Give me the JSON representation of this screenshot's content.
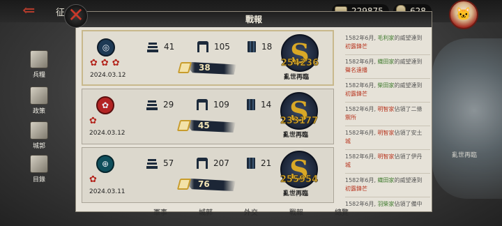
{
  "topbar": {
    "title": "征",
    "resource1": "229875",
    "resource2": "628"
  },
  "scene": {
    "caption": "亂世再臨"
  },
  "sidebar": {
    "items": [
      {
        "label": "兵糧",
        "icon": "grain-icon"
      },
      {
        "label": "政策",
        "icon": "book-icon"
      },
      {
        "label": "城郭",
        "icon": "castle-icon"
      },
      {
        "label": "目錄",
        "icon": "cards-icon"
      }
    ]
  },
  "panel": {
    "title": "戰報"
  },
  "records": [
    {
      "date": "2024.03.12",
      "castles": "41",
      "helmets": "105",
      "flags": "18",
      "brush": "38",
      "score": "254236",
      "season": "亂世再臨",
      "flowers": "✿✿✿",
      "mon": "◎",
      "mon_color": "#1e3a55"
    },
    {
      "date": "2024.03.12",
      "castles": "29",
      "helmets": "109",
      "flags": "14",
      "brush": "45",
      "score": "233177",
      "season": "亂世再臨",
      "flowers": "✿",
      "mon": "✿",
      "mon_color": "#b32424"
    },
    {
      "date": "2024.03.11",
      "castles": "57",
      "helmets": "207",
      "flags": "21",
      "brush": "76",
      "score": "255954",
      "season": "亂世再臨",
      "flowers": "✿",
      "mon": "⊕",
      "mon_color": "#0f4f5c"
    }
  ],
  "log": [
    {
      "pre": "1582年6月, ",
      "clan": "毛利家",
      "text": "的威望達到",
      "rank": "初露鋒芒"
    },
    {
      "pre": "1582年6月, ",
      "clan": "織田家",
      "text": "的威望達到",
      "rank": "聲名遠播"
    },
    {
      "pre": "1582年6月, ",
      "clan": "柴田家",
      "text": "的威望達到",
      "rank": "初露鋒芒"
    },
    {
      "pre": "1582年6月, ",
      "clan": "明智家",
      "text": "佔領了二條",
      "rank": "禦所"
    },
    {
      "pre": "1582年6月, ",
      "clan": "明智家",
      "text": "佔領了安土",
      "rank": "城"
    },
    {
      "pre": "1582年6月, ",
      "clan": "明智家",
      "text": "佔領了伊丹",
      "rank": "城"
    },
    {
      "pre": "1582年6月, ",
      "clan": "織田家",
      "text": "的威望達到",
      "rank": "初露鋒芒"
    },
    {
      "pre": "1582年6月, ",
      "clan": "羽柴家",
      "text": "佔領了備中",
      "rank": ""
    }
  ],
  "bottom_tabs": [
    "軍事",
    "城郭",
    "外交",
    "戰報",
    "總覽"
  ]
}
